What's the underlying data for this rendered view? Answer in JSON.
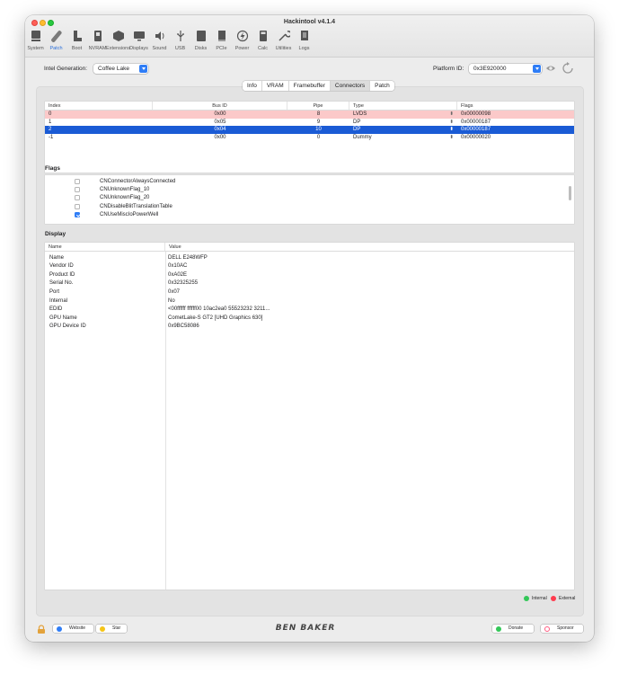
{
  "window": {
    "title": "Hackintool v4.1.4"
  },
  "toolbar": {
    "items": [
      {
        "label": "System",
        "icon": "system-icon"
      },
      {
        "label": "Patch",
        "icon": "patch-icon"
      },
      {
        "label": "Boot",
        "icon": "boot-icon"
      },
      {
        "label": "NVRAM",
        "icon": "nvram-icon"
      },
      {
        "label": "Extensions",
        "icon": "extensions-icon"
      },
      {
        "label": "Displays",
        "icon": "displays-icon"
      },
      {
        "label": "Sound",
        "icon": "sound-icon"
      },
      {
        "label": "USB",
        "icon": "usb-icon"
      },
      {
        "label": "Disks",
        "icon": "disks-icon"
      },
      {
        "label": "PCIe",
        "icon": "pcie-icon"
      },
      {
        "label": "Power",
        "icon": "power-icon"
      },
      {
        "label": "Calc",
        "icon": "calc-icon"
      },
      {
        "label": "Utilities",
        "icon": "utilities-icon"
      },
      {
        "label": "Logs",
        "icon": "logs-icon"
      }
    ],
    "active": "Patch"
  },
  "generation": {
    "label": "Intel Generation:",
    "value": "Coffee Lake"
  },
  "platform": {
    "label": "Platform ID:",
    "value": "0x3E920000"
  },
  "tabs": [
    "Info",
    "VRAM",
    "Framebuffer",
    "Connectors",
    "Patch"
  ],
  "active_tab": "Connectors",
  "connectors": {
    "columns": [
      "Index",
      "Bus ID",
      "Pipe",
      "Type",
      "Flags"
    ],
    "rows": [
      {
        "index": "0",
        "bus_id": "0x00",
        "pipe": "8",
        "type": "LVDS",
        "flags": "0x00000098"
      },
      {
        "index": "1",
        "bus_id": "0x05",
        "pipe": "9",
        "type": "DP",
        "flags": "0x00000187"
      },
      {
        "index": "2",
        "bus_id": "0x04",
        "pipe": "10",
        "type": "DP",
        "flags": "0x00000187"
      },
      {
        "index": "-1",
        "bus_id": "0x00",
        "pipe": "0",
        "type": "Dummy",
        "flags": "0x00000020"
      }
    ]
  },
  "flags_section": {
    "title": "Flags",
    "items": [
      {
        "label": "CNConnectorAlwaysConnected",
        "checked": false
      },
      {
        "label": "CNUnknownFlag_10",
        "checked": false
      },
      {
        "label": "CNUnknownFlag_20",
        "checked": false
      },
      {
        "label": "CNDisableBlitTranslationTable",
        "checked": false
      },
      {
        "label": "CNUseMiscIoPowerWell",
        "checked": true
      }
    ]
  },
  "display_section": {
    "title": "Display",
    "columns": [
      "Name",
      "Value"
    ],
    "rows": [
      {
        "name": "Name",
        "value": "DELL E248WFP"
      },
      {
        "name": "Vendor ID",
        "value": "0x10AC"
      },
      {
        "name": "Product ID",
        "value": "0xA02E"
      },
      {
        "name": "Serial No.",
        "value": "0x32325255"
      },
      {
        "name": "Port",
        "value": "0x07"
      },
      {
        "name": "Internal",
        "value": "No"
      },
      {
        "name": "EDID",
        "value": "<00ffffff ffffff00 10ac2ea0 55523232 3211..."
      },
      {
        "name": "GPU Name",
        "value": "CometLake-S GT2 [UHD Graphics 630]"
      },
      {
        "name": "GPU Device ID",
        "value": "0x9BC58086"
      }
    ]
  },
  "legend": {
    "internal": "Internal",
    "external": "External",
    "internal_color": "#34c759",
    "external_color": "#ff3b4e"
  },
  "footer": {
    "website": "Website",
    "star": "Star",
    "brand": "BEN BAKER",
    "donate": "Donate",
    "sponsor": "Sponsor"
  }
}
